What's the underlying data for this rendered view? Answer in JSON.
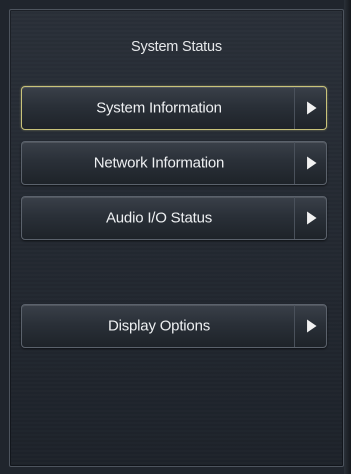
{
  "screen": {
    "title": "System Status"
  },
  "menu": {
    "items": [
      {
        "label": "System Information",
        "selected": true
      },
      {
        "label": "Network Information",
        "selected": false
      },
      {
        "label": "Audio I/O Status",
        "selected": false
      },
      {
        "label": "Display Options",
        "selected": false
      }
    ]
  },
  "icons": {
    "arrow": "chevron-right-icon"
  },
  "colors": {
    "selection_border": "#c9c37a",
    "text": "#eef0f2",
    "arrow": "#f2f2f2"
  }
}
